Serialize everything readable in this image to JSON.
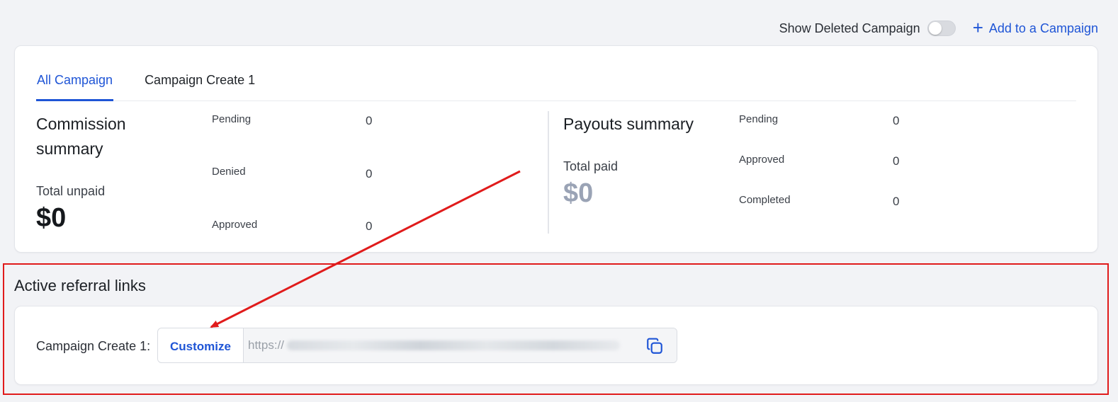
{
  "topbar": {
    "toggle_label": "Show Deleted Campaign",
    "toggle_on": false,
    "add_label": "Add to a Campaign"
  },
  "tabs": [
    {
      "label": "All Campaign",
      "active": true
    },
    {
      "label": "Campaign Create 1",
      "active": false
    }
  ],
  "commission": {
    "title_line1": "Commission",
    "title_line2": "summary",
    "total_label": "Total unpaid",
    "total_value": "$0",
    "stats": [
      {
        "label": "Pending",
        "value": "0"
      },
      {
        "label": "Denied",
        "value": "0"
      },
      {
        "label": "Approved",
        "value": "0"
      }
    ]
  },
  "payouts": {
    "title": "Payouts summary",
    "total_label": "Total paid",
    "total_value": "$0",
    "stats": [
      {
        "label": "Pending",
        "value": "0"
      },
      {
        "label": "Approved",
        "value": "0"
      },
      {
        "label": "Completed",
        "value": "0"
      }
    ]
  },
  "referral": {
    "section_title": "Active referral links",
    "link_label": "Campaign Create 1:",
    "customize_label": "Customize",
    "url_prefix": "https://"
  },
  "colors": {
    "accent": "#1f55d6",
    "annotation": "#e01b1b",
    "payout_total": "#9aa3b5"
  },
  "icons": [
    "plus-icon",
    "copy-icon"
  ]
}
